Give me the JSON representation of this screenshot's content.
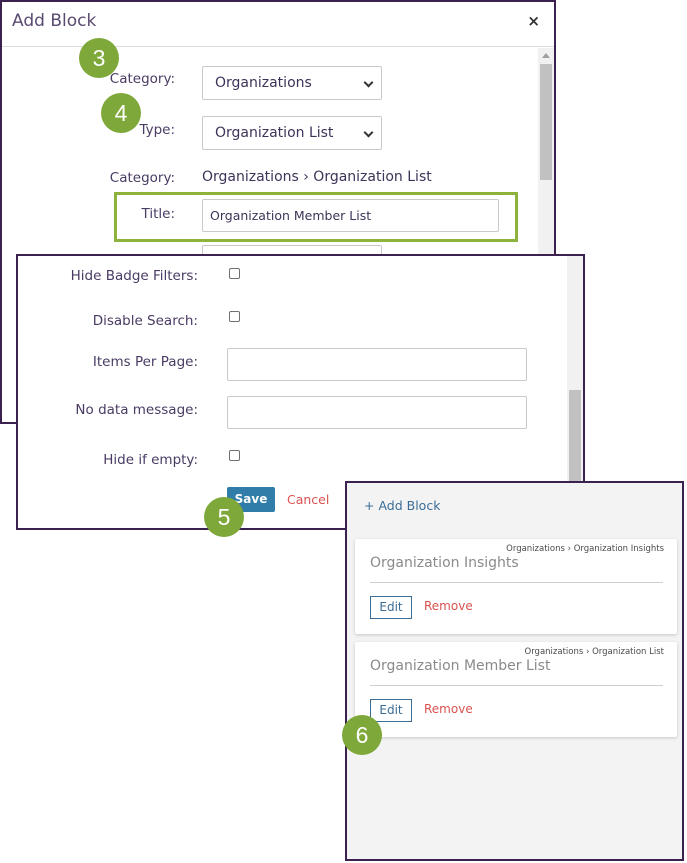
{
  "dialog": {
    "title": "Add Block",
    "close_glyph": "×",
    "fields": {
      "category_label": "Category:",
      "category_value": "Organizations",
      "type_label": "Type:",
      "type_value": "Organization List",
      "category_path_label": "Category:",
      "category_path_value": "Organizations › Organization List",
      "title_label": "Title:",
      "title_value": "Organization Member List"
    }
  },
  "form_lower": {
    "hide_badge_filters_label": "Hide Badge Filters:",
    "disable_search_label": "Disable Search:",
    "items_per_page_label": "Items Per Page:",
    "items_per_page_value": "",
    "no_data_message_label": "No data message:",
    "no_data_message_value": "",
    "hide_if_empty_label": "Hide if empty:",
    "save_label": "Save",
    "cancel_label": "Cancel"
  },
  "blocks": {
    "add_block_label": "+ Add Block",
    "items": [
      {
        "crumb": "Organizations › Organization Insights",
        "title": "Organization Insights",
        "edit_label": "Edit",
        "remove_label": "Remove"
      },
      {
        "crumb": "Organizations › Organization List",
        "title": "Organization Member List",
        "edit_label": "Edit",
        "remove_label": "Remove"
      }
    ]
  },
  "badges": [
    "3",
    "4",
    "5",
    "6"
  ],
  "colors": {
    "badge": "#7fa83a",
    "highlight": "#8db33c",
    "panel_border": "#3a2150",
    "save_button": "#2f7da8",
    "link": "#3b6d96",
    "remove": "#d9534f"
  }
}
